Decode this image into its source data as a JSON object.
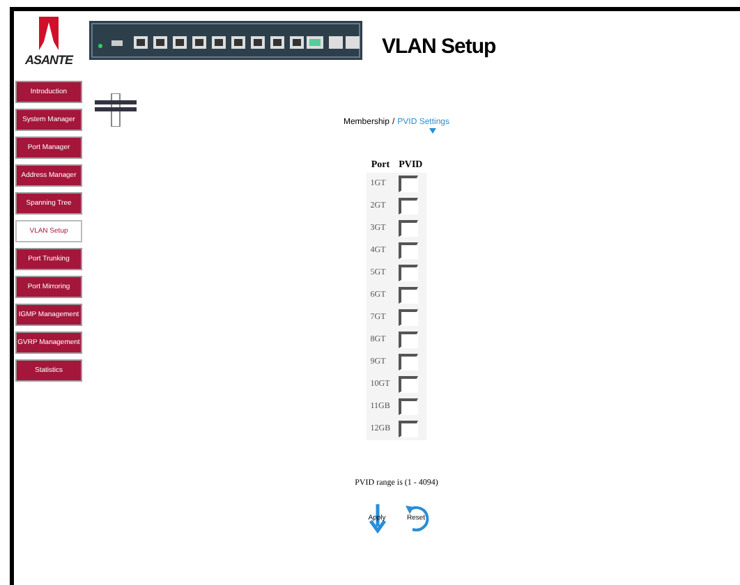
{
  "brand": {
    "logo_text": "ASANTE"
  },
  "nav": [
    {
      "label": "Introduction",
      "selected": false
    },
    {
      "label": "System Manager",
      "selected": false
    },
    {
      "label": "Port Manager",
      "selected": false
    },
    {
      "label": "Address Manager",
      "selected": false
    },
    {
      "label": "Spanning Tree",
      "selected": false
    },
    {
      "label": "VLAN Setup",
      "selected": true
    },
    {
      "label": "Port Trunking",
      "selected": false
    },
    {
      "label": "Port Mirroring",
      "selected": false
    },
    {
      "label": "IGMP Management",
      "selected": false
    },
    {
      "label": "GVRP Management",
      "selected": false
    },
    {
      "label": "Statistics",
      "selected": false
    }
  ],
  "page_title": "VLAN Setup",
  "breadcrumb": {
    "first": "Membership",
    "separator": "/",
    "current": "PVID Settings"
  },
  "table": {
    "columns": [
      "Port",
      "PVID"
    ],
    "rows": [
      {
        "port": "1GT"
      },
      {
        "port": "2GT"
      },
      {
        "port": "3GT"
      },
      {
        "port": "4GT"
      },
      {
        "port": "5GT"
      },
      {
        "port": "6GT"
      },
      {
        "port": "7GT"
      },
      {
        "port": "8GT"
      },
      {
        "port": "9GT"
      },
      {
        "port": "10GT"
      },
      {
        "port": "11GB"
      },
      {
        "port": "12GB"
      }
    ]
  },
  "note": "PVID range is (1 - 4094)",
  "buttons": [
    {
      "label": "Apply",
      "kind": "apply"
    },
    {
      "label": "Reset",
      "kind": "reset"
    }
  ]
}
